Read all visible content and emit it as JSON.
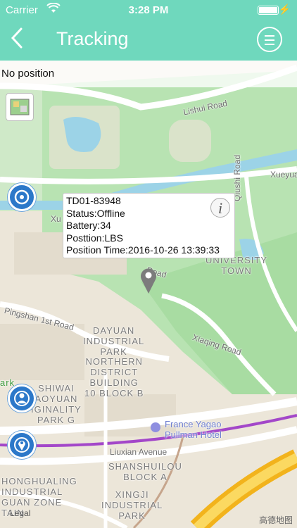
{
  "status_bar": {
    "carrier": "Carrier",
    "time": "3:28 PM"
  },
  "nav": {
    "title": "Tracking"
  },
  "map": {
    "notice": "No position",
    "roads": {
      "lishui": "Lishui Road",
      "xueyua": "Xueyua",
      "qiushi": "Qiushi Road",
      "xue_left": "Xu",
      "road_fragment": "Road",
      "pingshan": "Pingshan 1st Road",
      "xiaqing": "Xiaqing Road",
      "liuxian": "Liuxian Avenue"
    },
    "labels": {
      "university_town": "UNIVERSITY\nTOWN",
      "dayuan": "DAYUAN\nINDUSTRIAL\nPARK",
      "northern": "NORTHERN\nDISTRICT\nBUILDING\n10 BLOCK B",
      "shiwai": "SHIWAI\nAOYUAN\nIGINALITY\nPARK G",
      "park": "ark",
      "hotel": "France Yagao\nPullman Hotel",
      "shanshuilou": "SHANSHUILOU\nBLOCK A",
      "honghualing": "HONGHUALING\nINDUSTRIAL\nGUAN ZONE\nTAIN",
      "xingji": "XINGJI\nINDUSTRIAL\nPARK"
    },
    "attribution": "Legal",
    "brand": "高德地图"
  },
  "device_popup": {
    "device_id": "TD01-83948",
    "status": "Status:Offline",
    "battery": "Battery:34",
    "position": "Posttion:LBS",
    "position_time": "Position Time:2016-10-26 13:39:33"
  },
  "colors": {
    "accent": "#6fd8bd",
    "button_blue": "#2c78c9",
    "route_purple": "#a347c9"
  }
}
